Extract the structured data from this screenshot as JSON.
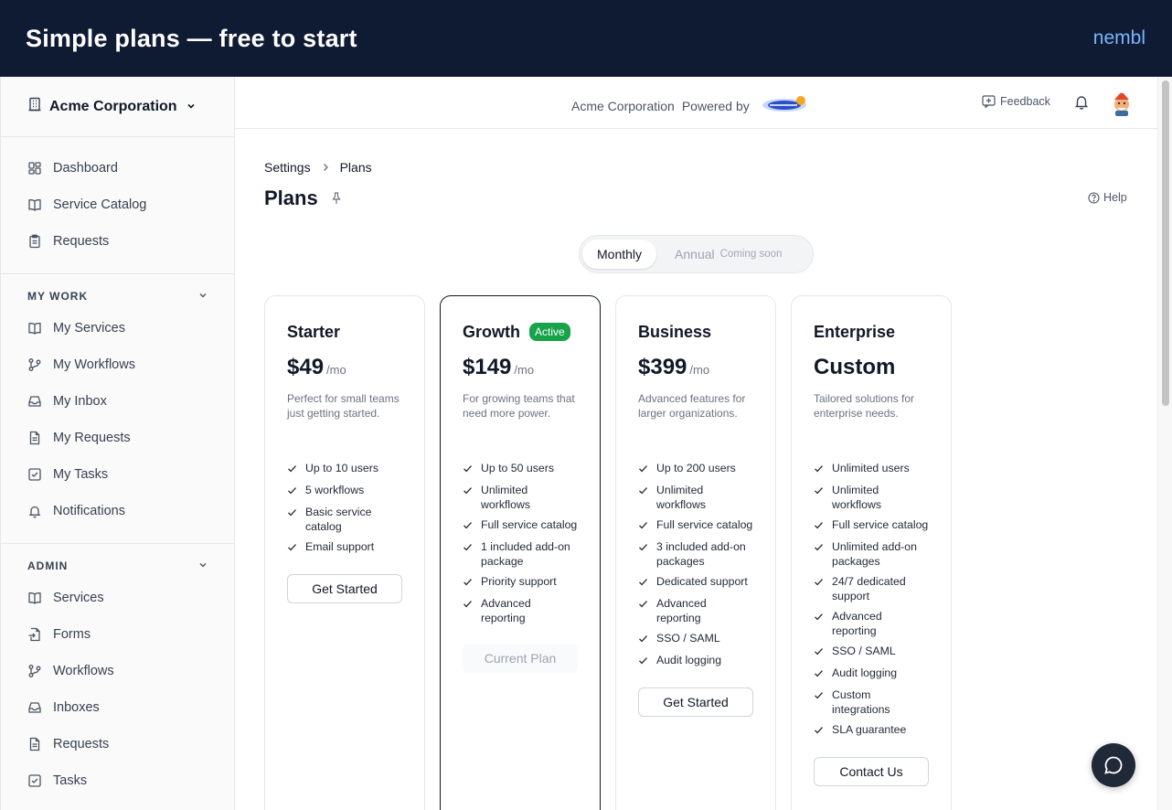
{
  "banner": {
    "title": "Simple plans — free to start",
    "brand": "nembl"
  },
  "sidebar": {
    "org_name": "Acme Corporation",
    "top_items": [
      {
        "label": "Dashboard",
        "icon": "dashboard-icon"
      },
      {
        "label": "Service Catalog",
        "icon": "book-icon"
      },
      {
        "label": "Requests",
        "icon": "clipboard-icon"
      }
    ],
    "my_work": {
      "title": "MY WORK",
      "items": [
        {
          "label": "My Services",
          "icon": "book-icon"
        },
        {
          "label": "My Workflows",
          "icon": "workflow-icon"
        },
        {
          "label": "My Inbox",
          "icon": "inbox-icon"
        },
        {
          "label": "My Requests",
          "icon": "document-icon"
        },
        {
          "label": "My Tasks",
          "icon": "task-icon"
        },
        {
          "label": "Notifications",
          "icon": "bell-icon"
        }
      ]
    },
    "admin": {
      "title": "ADMIN",
      "items": [
        {
          "label": "Services",
          "icon": "book-icon"
        },
        {
          "label": "Forms",
          "icon": "form-icon"
        },
        {
          "label": "Workflows",
          "icon": "workflow-icon"
        },
        {
          "label": "Inboxes",
          "icon": "inbox-icon"
        },
        {
          "label": "Requests",
          "icon": "document-icon"
        },
        {
          "label": "Tasks",
          "icon": "task-icon"
        }
      ]
    }
  },
  "topbar": {
    "org_name": "Acme Corporation",
    "powered_by": "Powered by",
    "feedback_label": "Feedback"
  },
  "breadcrumb": {
    "parent": "Settings",
    "current": "Plans"
  },
  "page": {
    "title": "Plans",
    "help_label": "Help"
  },
  "billing_toggle": {
    "monthly": "Monthly",
    "annual": "Annual",
    "annual_note": "Coming soon"
  },
  "plans": [
    {
      "name": "Starter",
      "badge": "",
      "price": "$49",
      "period": "/mo",
      "description": "Perfect for small teams just getting started.",
      "features": [
        "Up to 10 users",
        "5 workflows",
        "Basic service catalog",
        "Email support"
      ],
      "button": "Get Started"
    },
    {
      "name": "Growth",
      "badge": "Active",
      "price": "$149",
      "period": "/mo",
      "description": "For growing teams that need more power.",
      "features": [
        "Up to 50 users",
        "Unlimited workflows",
        "Full service catalog",
        "1 included add-on package",
        "Priority support",
        "Advanced reporting"
      ],
      "button": "Current Plan"
    },
    {
      "name": "Business",
      "badge": "",
      "price": "$399",
      "period": "/mo",
      "description": "Advanced features for larger organizations.",
      "features": [
        "Up to 200 users",
        "Unlimited workflows",
        "Full service catalog",
        "3 included add-on packages",
        "Dedicated support",
        "Advanced reporting",
        "SSO / SAML",
        "Audit logging"
      ],
      "button": "Get Started"
    },
    {
      "name": "Enterprise",
      "badge": "",
      "price": "Custom",
      "period": "",
      "description": "Tailored solutions for enterprise needs.",
      "features": [
        "Unlimited users",
        "Unlimited workflows",
        "Full service catalog",
        "Unlimited add-on packages",
        "24/7 dedicated support",
        "Advanced reporting",
        "SSO / SAML",
        "Audit logging",
        "Custom integrations",
        "SLA guarantee"
      ],
      "button": "Contact Us"
    }
  ],
  "colors": {
    "banner_bg": "#0f1a33",
    "brand": "#7ab7ff",
    "active_badge": "#16a34a"
  }
}
